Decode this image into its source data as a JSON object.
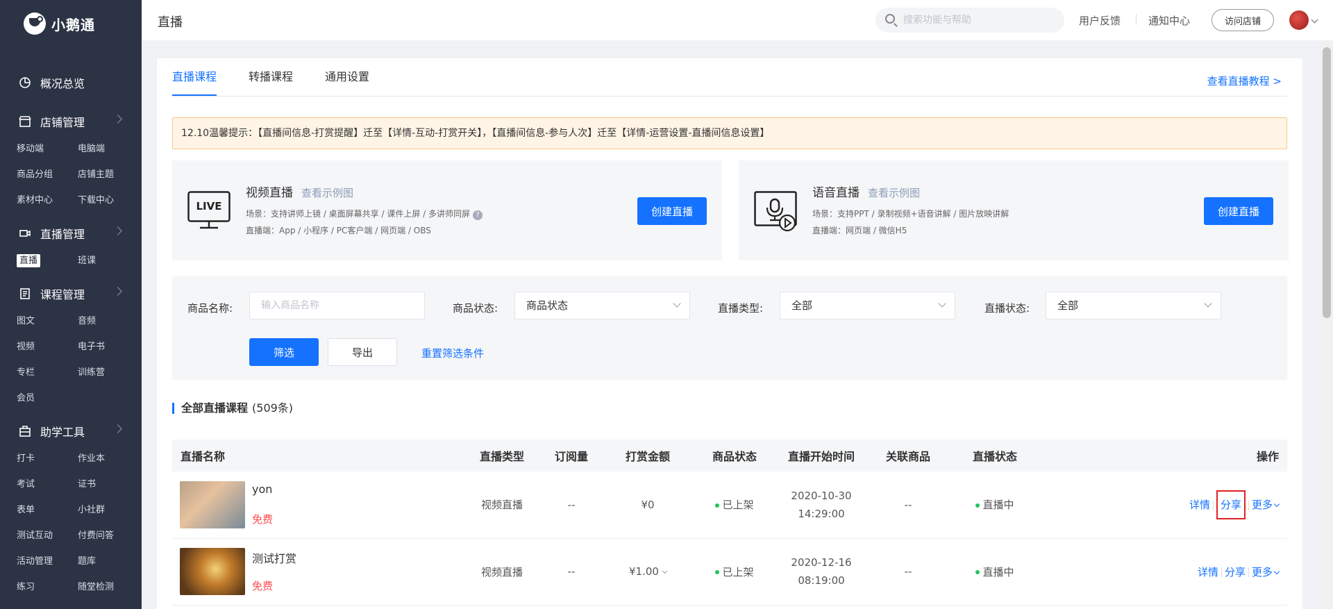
{
  "brand": {
    "name": "小鹅通"
  },
  "sidebar": {
    "groups": [
      {
        "label": "概况总览",
        "items": []
      },
      {
        "label": "店铺管理",
        "items": [
          "移动端",
          "电脑端",
          "商品分组",
          "店铺主题",
          "素材中心",
          "下载中心"
        ]
      },
      {
        "label": "直播管理",
        "items": [
          "直播",
          "班课"
        ],
        "active": "直播"
      },
      {
        "label": "课程管理",
        "items": [
          "图文",
          "音频",
          "视频",
          "电子书",
          "专栏",
          "训练营",
          "会员"
        ]
      },
      {
        "label": "助学工具",
        "items": [
          "打卡",
          "作业本",
          "考试",
          "证书",
          "表单",
          "小社群",
          "测试互动",
          "付费问答",
          "活动管理",
          "题库",
          "练习",
          "随堂检测"
        ]
      }
    ]
  },
  "header": {
    "title": "直播",
    "search_placeholder": "搜索功能与帮助",
    "feedback": "用户反馈",
    "notifications": "通知中心",
    "visit_store": "访问店铺"
  },
  "tabs": [
    {
      "label": "直播课程",
      "active": true
    },
    {
      "label": "转播课程",
      "active": false
    },
    {
      "label": "通用设置",
      "active": false
    }
  ],
  "tutorial_link": "查看直播教程 >",
  "notice": "12.10温馨提示：【直播间信息-打赏提醒】迁至【详情-互动-打赏开关】，【直播间信息-参与人次】迁至【详情-运营设置-直播间信息设置】",
  "live_types": {
    "video": {
      "title": "视频直播",
      "sample": "查看示例图",
      "scene": "场景：支持讲师上镜 / 桌面屏幕共享 / 课件上屏 / 多讲师同屏",
      "client": "直播端：App / 小程序 / PC客户端 / 网页端 / OBS",
      "button": "创建直播",
      "icon_text": "LIVE"
    },
    "audio": {
      "title": "语音直播",
      "sample": "查看示例图",
      "scene": "场景：支持PPT / 录制视频+语音讲解 / 图片放映讲解",
      "client": "直播端：网页端 / 微信H5",
      "button": "创建直播"
    }
  },
  "filters": {
    "product_name_label": "商品名称:",
    "product_name_placeholder": "输入商品名称",
    "product_status_label": "商品状态:",
    "product_status_value": "商品状态",
    "live_type_label": "直播类型:",
    "live_type_value": "全部",
    "live_status_label": "直播状态:",
    "live_status_value": "全部",
    "filter_button": "筛选",
    "export_button": "导出",
    "reset_link": "重置筛选条件"
  },
  "list": {
    "title": "全部直播课程",
    "count": "(509条)",
    "columns": [
      "直播名称",
      "直播类型",
      "订阅量",
      "打赏金额",
      "商品状态",
      "直播开始时间",
      "关联商品",
      "直播状态",
      "操作"
    ],
    "rows": [
      {
        "name": "yon",
        "price": "免费",
        "type": "视频直播",
        "subs": "--",
        "reward": "¥0",
        "product_status": "已上架",
        "date": "2020-10-30",
        "time": "14:29:00",
        "related": "--",
        "live_status": "直播中",
        "op_detail": "详情",
        "op_share": "分享",
        "op_more": "更多"
      },
      {
        "name": "测试打赏",
        "price": "免费",
        "type": "视频直播",
        "subs": "--",
        "reward": "¥1.00",
        "product_status": "已上架",
        "date": "2020-12-16",
        "time": "08:19:00",
        "related": "--",
        "live_status": "直播中",
        "op_detail": "详情",
        "op_share": "分享",
        "op_more": "更多"
      }
    ]
  },
  "colors": {
    "primary": "#1472ff",
    "sidebar": "#2c3345",
    "free": "#ff4d4f",
    "live_dot": "#22c55e",
    "highlight_border": "#e02020"
  }
}
